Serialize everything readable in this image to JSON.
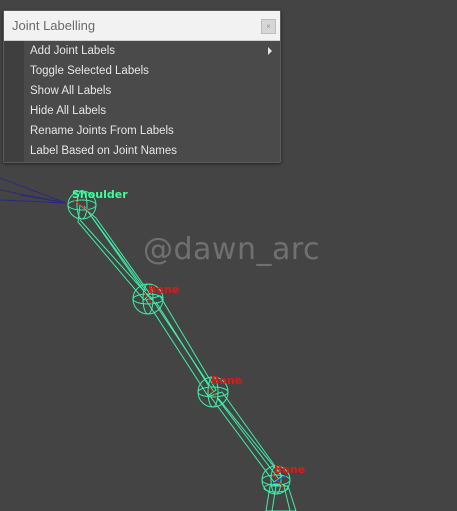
{
  "panel": {
    "title": "Joint Labelling",
    "close_glyph": "×",
    "items": [
      {
        "label": "Add Joint Labels",
        "has_submenu": true
      },
      {
        "label": "Toggle Selected Labels"
      },
      {
        "label": "Show All Labels"
      },
      {
        "label": "Hide All Labels"
      },
      {
        "label": "Rename Joints From Labels"
      },
      {
        "label": "Label Based on Joint Names"
      }
    ]
  },
  "viewport": {
    "watermark": "@dawn_arc",
    "labels": {
      "shoulder": "Shoulder",
      "bone1": "Bone",
      "bone2": "Bone",
      "bone3": "Bone"
    }
  },
  "colors": {
    "viewport_bg": "#444444",
    "joint_green": "#3cff9a",
    "label_red": "#e01818"
  }
}
